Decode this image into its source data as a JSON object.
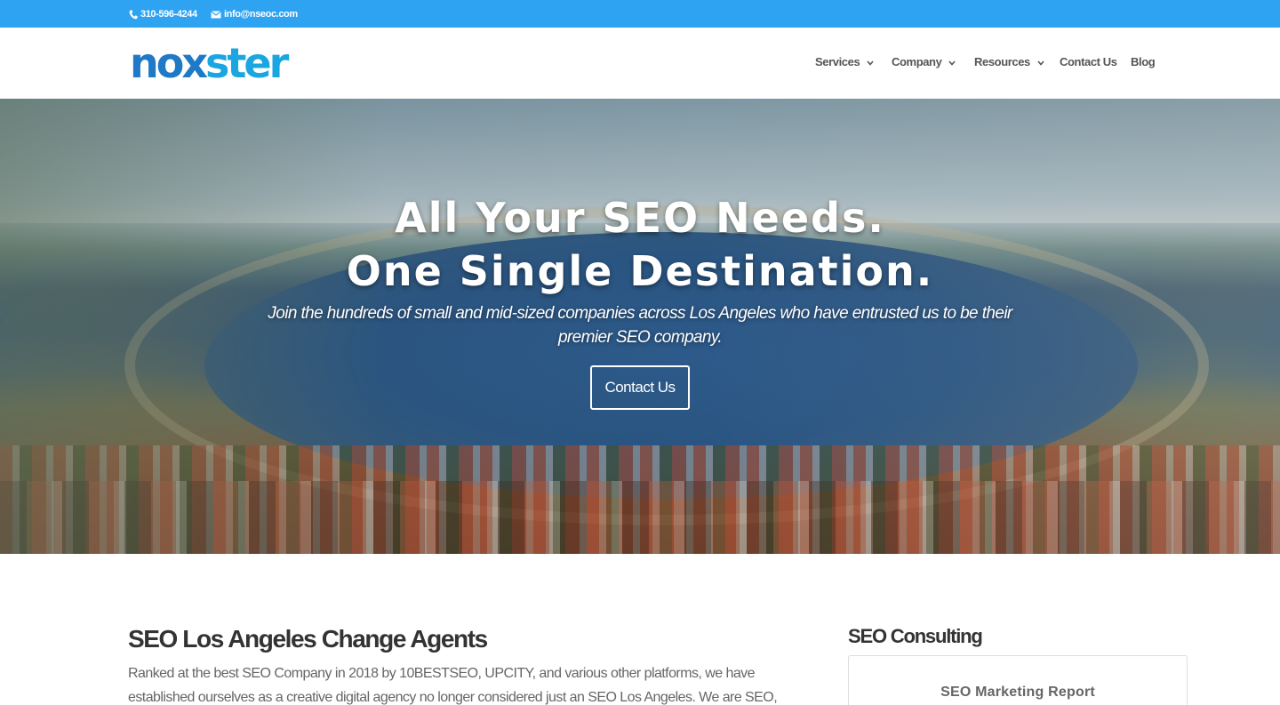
{
  "topbar": {
    "phone": "310-596-4244",
    "email": "info@nseoc.com",
    "background": "#2ea3f2"
  },
  "logo": {
    "part1": "no",
    "part2": "x",
    "part3": "ster",
    "color_primary": "#1f79c7",
    "color_secondary": "#1aa6e0"
  },
  "nav": {
    "items": [
      {
        "label": "Services",
        "has_dropdown": true
      },
      {
        "label": "Company",
        "has_dropdown": true
      },
      {
        "label": "Resources",
        "has_dropdown": true
      },
      {
        "label": "Contact Us",
        "has_dropdown": false
      },
      {
        "label": "Blog",
        "has_dropdown": false
      }
    ]
  },
  "hero": {
    "title_line1": "All Your SEO Needs.",
    "title_line2": "One Single Destination.",
    "subtitle": "Join the hundreds of small and  mid-sized companies across Los Angeles who have entrusted us to be their premier SEO company.",
    "button_label": "Contact Us"
  },
  "content": {
    "title": "SEO Los Angeles Change Agents",
    "paragraph": "Ranked at the best SEO Company in 2018 by 10BESTSEO, UPCITY, and various other platforms, we have established ourselves as a creative digital agency no longer considered just an SEO  Los Angeles. We are SEO, Google Adwords Certified, Facebook Lead,"
  },
  "sidebar": {
    "title": "SEO Consulting",
    "card_title": "SEO Marketing Report"
  }
}
